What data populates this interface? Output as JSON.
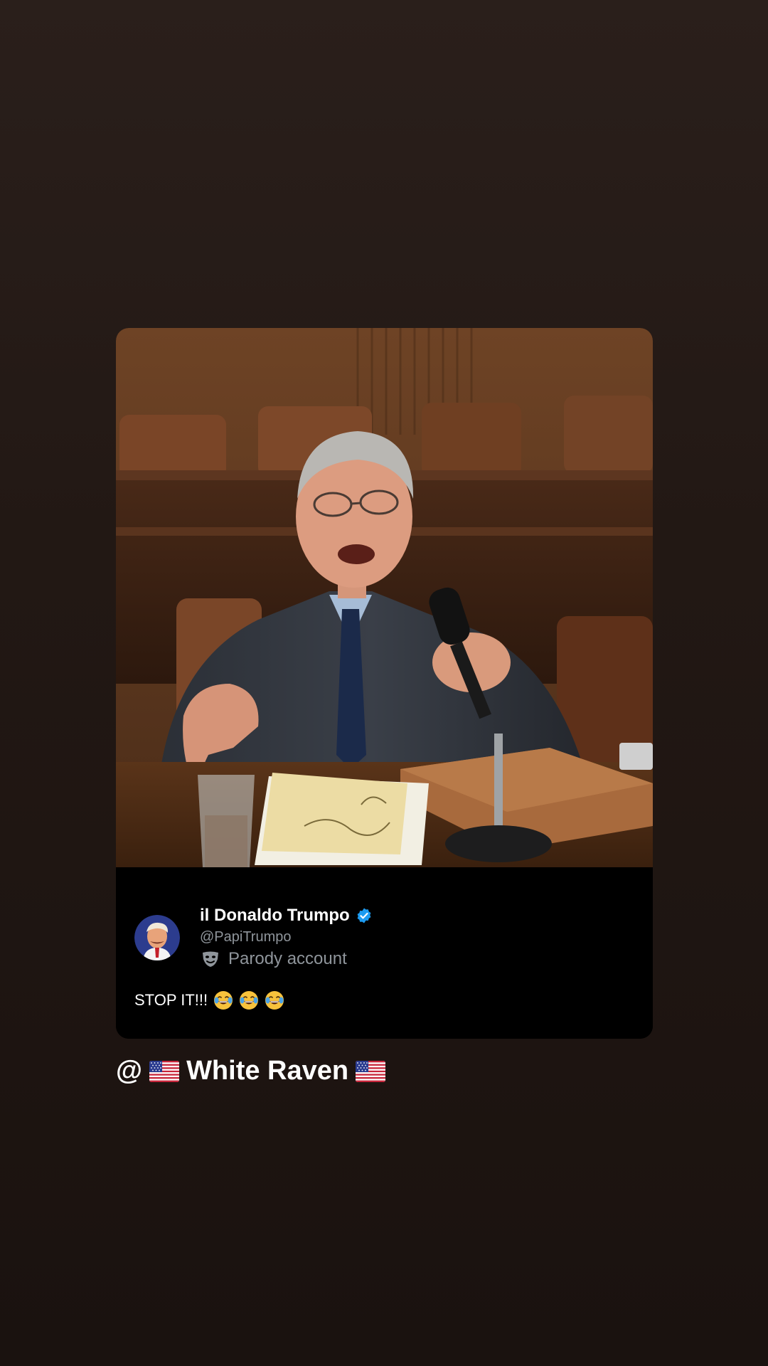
{
  "tweet": {
    "display_name": "il Donaldo Trumpo",
    "handle": "@PapiTrumpo",
    "parody_label": "Parody account",
    "text": "STOP IT!!!",
    "emojis": [
      "laughing-tears-emoji",
      "laughing-tears-emoji",
      "laughing-tears-emoji"
    ],
    "verified": true,
    "verified_color": "#1d9bf0"
  },
  "mention": {
    "prefix": "@",
    "name": "White Raven",
    "flag_icon": "us-flag-icon"
  },
  "colors": {
    "background": "#221814",
    "card_background": "#000000",
    "secondary_text": "#8f959b"
  }
}
